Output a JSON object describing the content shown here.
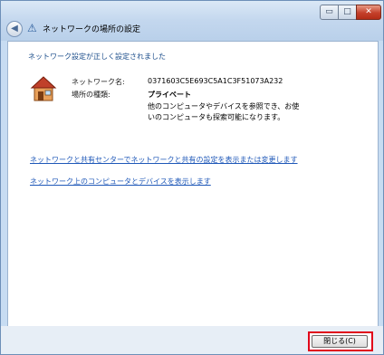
{
  "window": {
    "title": "ネットワークの場所の設定",
    "controls": {
      "minimize": "▭",
      "maximize": "□",
      "close": "✕"
    }
  },
  "content": {
    "success_message": "ネットワーク設定が正しく設定されました",
    "network_name_label": "ネットワーク名:",
    "network_name_value": "0371603C5E693C5A1C3F51073A232",
    "location_type_label": "場所の種類:",
    "location_type_value": "プライベート",
    "description": "他のコンピュータやデバイスを参照でき、お使いのコンピュータも探索可能になります。",
    "link_sharing_center": "ネットワークと共有センターでネットワークと共有の設定を表示または変更します",
    "link_view_computers": "ネットワーク上のコンピュータとデバイスを表示します"
  },
  "footer": {
    "close_button_label": "閉じる(C)"
  },
  "colors": {
    "link": "#1f58b8",
    "highlight_border": "#e0001a",
    "success_text": "#1a4c8a"
  },
  "icons": {
    "back": "back-arrow-icon",
    "network": "network-icon",
    "house": "house-icon"
  }
}
